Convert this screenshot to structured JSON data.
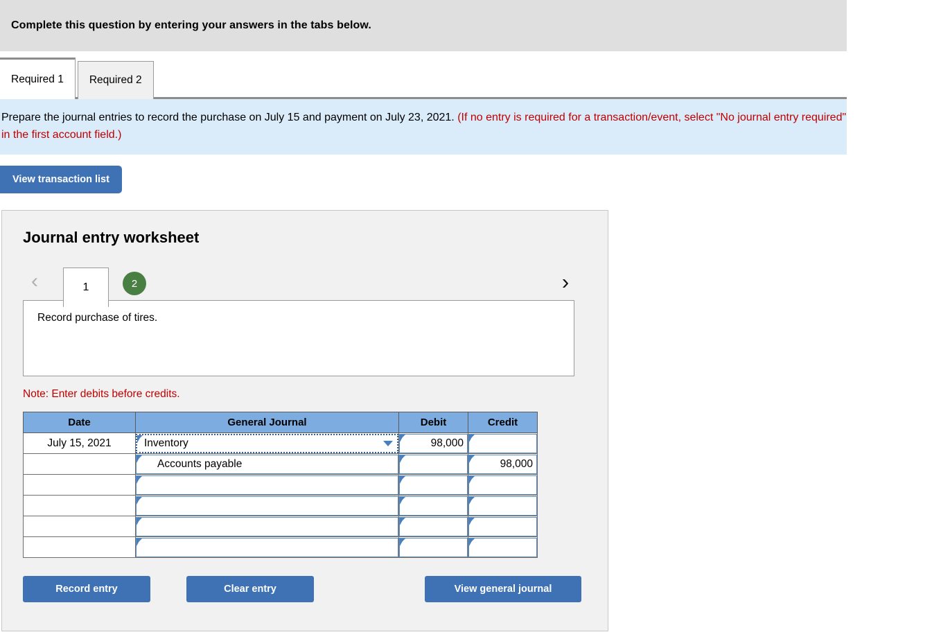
{
  "header": {
    "banner_text": "Complete this question by entering your answers in the tabs below."
  },
  "tabs": [
    {
      "label": "Required 1",
      "active": true
    },
    {
      "label": "Required 2",
      "active": false
    }
  ],
  "instruction": {
    "black_text": "Prepare the journal entries to record the purchase on July 15 and payment on July 23, 2021. ",
    "red_text": "(If no entry is required for a transaction/event, select \"No journal entry required\" in the first account field.)"
  },
  "toolbar": {
    "view_transaction_list_label": "View transaction list"
  },
  "worksheet": {
    "title": "Journal entry worksheet",
    "pager": {
      "prev_icon": "chevron-left-icon",
      "next_icon": "chevron-right-icon",
      "pages": [
        {
          "label": "1",
          "state": "selected"
        },
        {
          "label": "2",
          "state": "completed"
        }
      ]
    },
    "description": "Record purchase of tires.",
    "note": "Note: Enter debits before credits.",
    "table": {
      "columns": [
        "Date",
        "General Journal",
        "Debit",
        "Credit"
      ],
      "rows": [
        {
          "date": "July 15, 2021",
          "account": "Inventory",
          "indent": false,
          "debit": "98,000",
          "credit": "",
          "focused": true,
          "has_dropdown": true
        },
        {
          "date": "",
          "account": "Accounts payable",
          "indent": true,
          "debit": "",
          "credit": "98,000",
          "focused": false,
          "has_dropdown": false
        },
        {
          "date": "",
          "account": "",
          "indent": false,
          "debit": "",
          "credit": "",
          "focused": false,
          "has_dropdown": false
        },
        {
          "date": "",
          "account": "",
          "indent": false,
          "debit": "",
          "credit": "",
          "focused": false,
          "has_dropdown": false
        },
        {
          "date": "",
          "account": "",
          "indent": false,
          "debit": "",
          "credit": "",
          "focused": false,
          "has_dropdown": false
        },
        {
          "date": "",
          "account": "",
          "indent": false,
          "debit": "",
          "credit": "",
          "focused": false,
          "has_dropdown": false
        }
      ]
    },
    "buttons": {
      "record_entry": "Record entry",
      "clear_entry": "Clear entry",
      "view_general_journal": "View general journal"
    }
  },
  "colors": {
    "banner_grey": "#dfdfdf",
    "instruction_blue": "#daebfa",
    "button_blue": "#3f72b4",
    "table_header_blue": "#7cace0",
    "accent_red": "#c00000",
    "page_dot_green": "#4a7f43",
    "panel_grey": "#f1f1f1"
  }
}
